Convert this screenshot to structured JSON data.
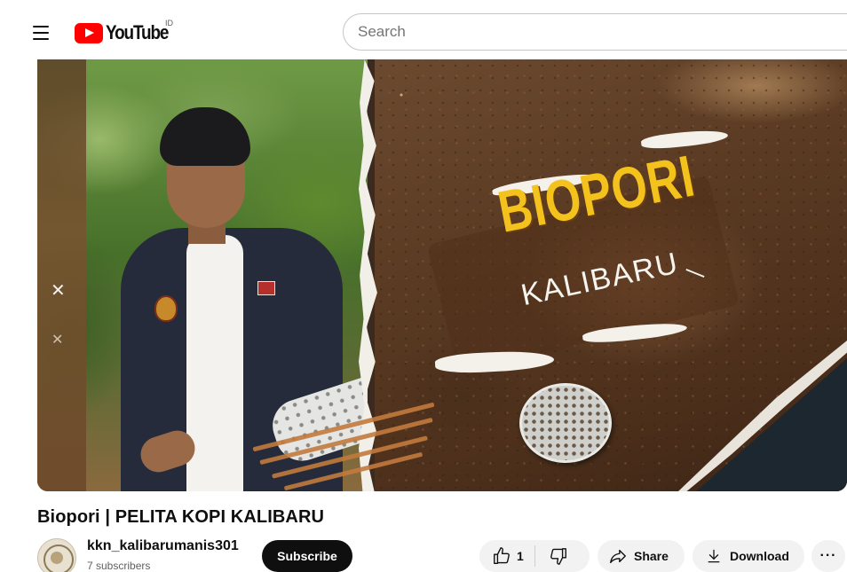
{
  "header": {
    "logo_text": "YouTube",
    "country_code": "ID",
    "search_placeholder": "Search"
  },
  "video": {
    "thumbnail_title": "BIOPORI",
    "thumbnail_subtitle": "KALIBARU",
    "title": "Biopori | PELITA KOPI KALIBARU"
  },
  "channel": {
    "name": "kkn_kalibarumanis301",
    "subscribers": "7 subscribers",
    "subscribe_label": "Subscribe"
  },
  "actions": {
    "like_count": "1",
    "share_label": "Share",
    "download_label": "Download",
    "more_label": "···"
  },
  "icons": {
    "menu": "hamburger-menu-icon",
    "like": "thumbs-up-icon",
    "dislike": "thumbs-down-icon",
    "share": "share-arrow-icon",
    "download": "download-icon",
    "more": "more-horizontal-icon"
  },
  "colors": {
    "brand_red": "#ff0000",
    "subscribe_bg": "#0f0f0f",
    "pill_bg": "#f2f2f2",
    "thumbnail_title": "#f4c21c"
  }
}
